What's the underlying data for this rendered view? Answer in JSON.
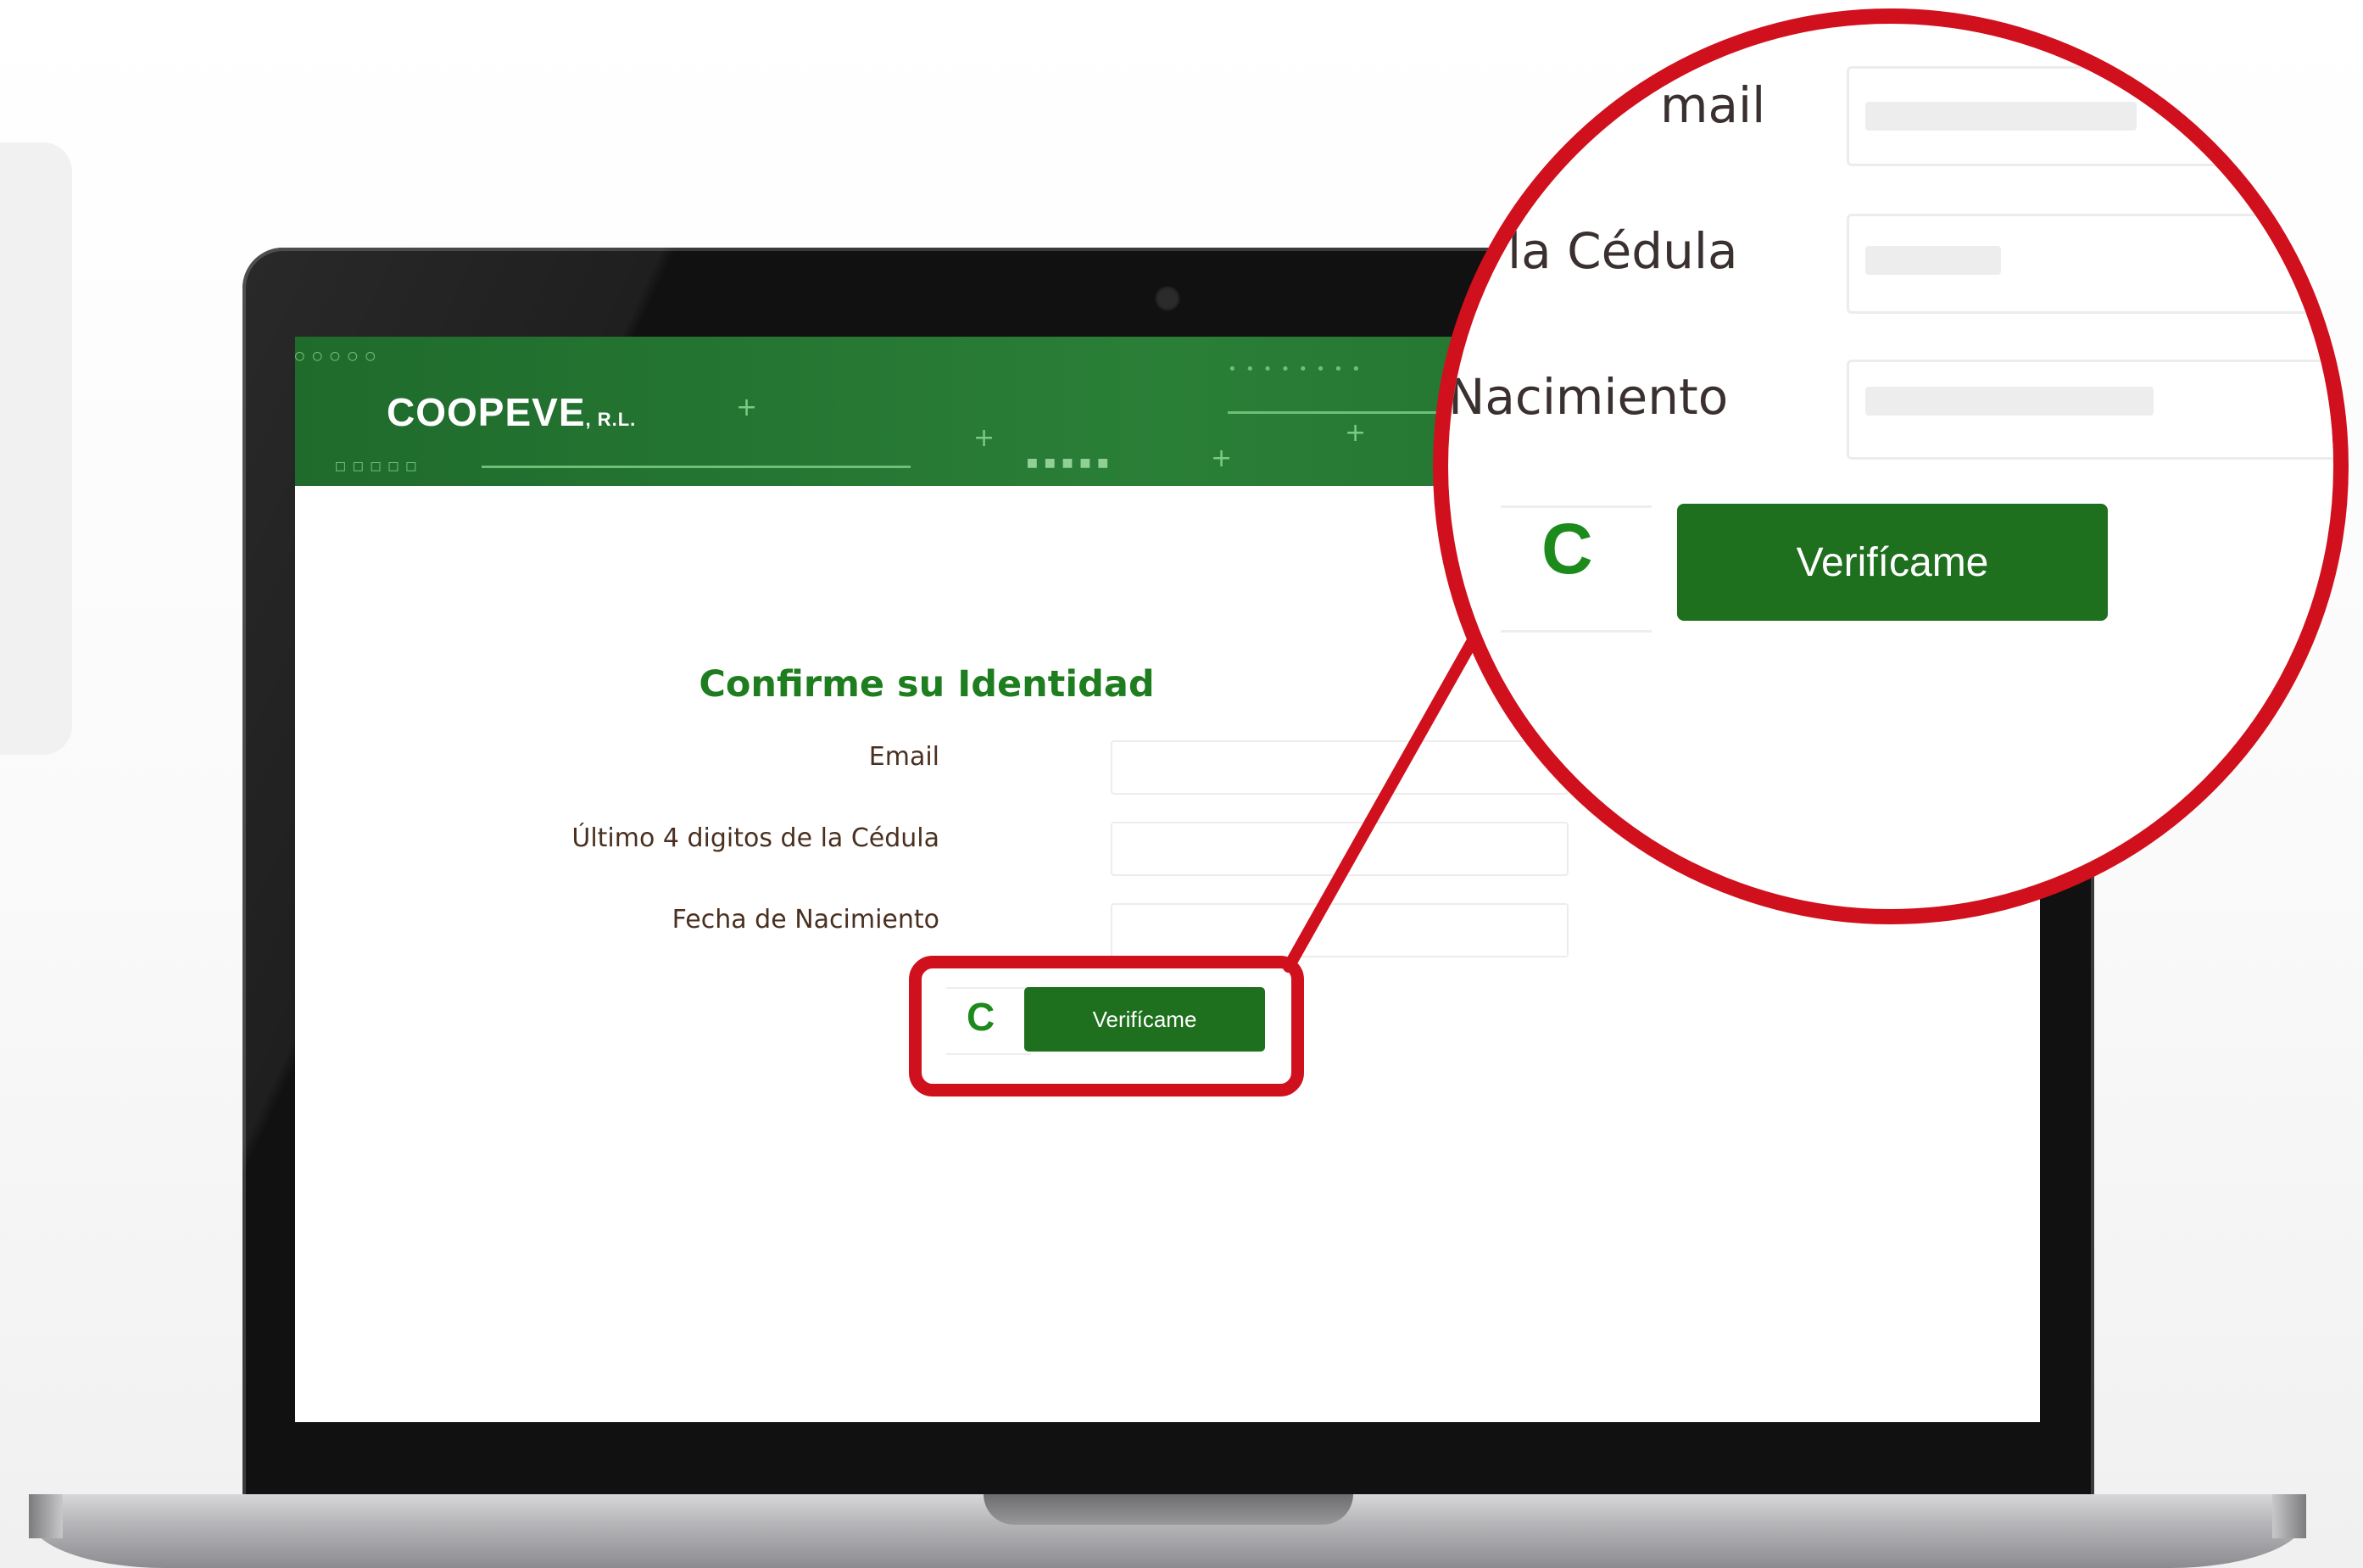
{
  "brand": {
    "name": "Coopeve",
    "suffix": ", R.L."
  },
  "form": {
    "title": "Confirme su Identidad",
    "email_label": "Email",
    "cedula_label": "Último 4 digitos de la Cédula",
    "birth_label": "Fecha de Nacimiento",
    "email_value": "",
    "cedula_value": "",
    "birth_value": "",
    "captcha_letter": "C",
    "verify_button": "Verifícame"
  },
  "zoom": {
    "email_label_fragment": "mail",
    "cedula_label_fragment": "la Cédula",
    "birth_label_fragment": "Nacimiento",
    "captcha_letter": "C",
    "verify_button": "Verifícame"
  },
  "colors": {
    "accent": "#d1101e",
    "brand_green": "#1e6f1e",
    "title_green": "#1e7d1e"
  }
}
